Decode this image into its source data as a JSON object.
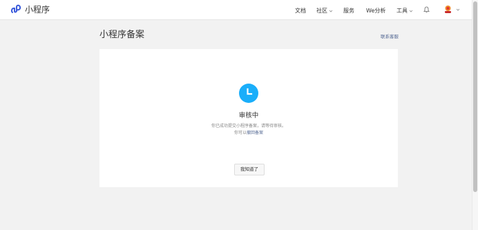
{
  "header": {
    "brand": "小程序",
    "nav": {
      "docs": "文档",
      "community": "社区",
      "service": "服务",
      "we_analysis": "We分析",
      "tools": "工具"
    }
  },
  "page": {
    "title": "小程序备案",
    "contact": "联系客服"
  },
  "card": {
    "status": "审核中",
    "desc_line1": "你已成功提交小程序备案，请等待审核。",
    "desc_line2_prefix": "你可以",
    "desc_line2_link": "撤回备案",
    "ok_button": "我知道了"
  },
  "colors": {
    "accent_blue": "#1aaefa",
    "link": "#576b95",
    "brand_blue": "#3b5bdb"
  },
  "icons": [
    "miniprogram-logo-icon",
    "chevron-down-icon",
    "bell-icon",
    "avatar",
    "clock-icon"
  ]
}
